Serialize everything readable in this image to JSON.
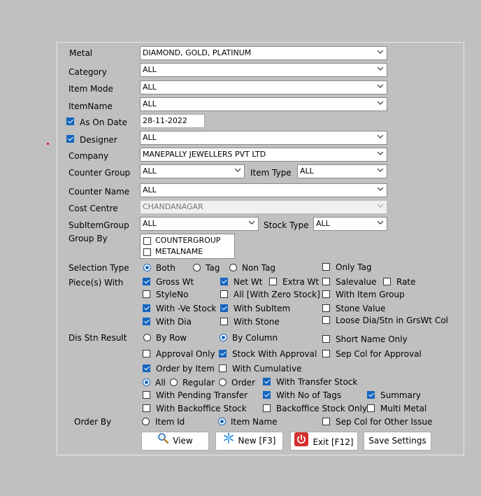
{
  "form": {
    "metal": {
      "label": "Metal",
      "value": "DIAMOND, GOLD, PLATINUM"
    },
    "category": {
      "label": "Category",
      "value": "ALL"
    },
    "item_mode": {
      "label": "Item Mode",
      "value": "ALL"
    },
    "item_name": {
      "label": "ItemName",
      "value": "ALL"
    },
    "as_on_date": {
      "label": "As On Date",
      "value": "28-11-2022",
      "checked": true
    },
    "designer": {
      "label": "Designer",
      "value": "ALL",
      "checked": true
    },
    "company": {
      "label": "Company",
      "value": "MANEPALLY JEWELLERS PVT LTD"
    },
    "counter_group": {
      "label": "Counter Group",
      "value": "ALL"
    },
    "item_type": {
      "label": "Item Type",
      "value": "ALL"
    },
    "counter_name": {
      "label": "Counter Name",
      "value": "ALL"
    },
    "cost_centre": {
      "label": "Cost Centre",
      "value": "CHANDANAGAR"
    },
    "sub_item_group": {
      "label": "SubItemGroup",
      "value": "ALL"
    },
    "stock_type": {
      "label": "Stock Type",
      "value": "ALL"
    },
    "group_by": {
      "label": "Group By",
      "items": [
        "COUNTERGROUP",
        "METALNAME"
      ]
    }
  },
  "selection_type": {
    "label": "Selection Type",
    "options": [
      "Both",
      "Tag",
      "Non Tag"
    ],
    "selected": "Both",
    "only_tag": "Only Tag"
  },
  "pieces_with": {
    "label": "Piece(s) With",
    "gross_wt": "Gross Wt",
    "net_wt": "Net Wt",
    "extra_wt": "Extra Wt",
    "salevalue": "Salevalue",
    "rate": "Rate",
    "style_no": "StyleNo",
    "all_zero_stock": "All [With Zero Stock]",
    "with_item_group": "With  Item Group",
    "with_ve_stock": "With -Ve Stock",
    "with_subitem": "With SubItem",
    "stone_value": "Stone Value",
    "with_dia": "With Dia",
    "with_stone": "With Stone",
    "loose_dia": "Loose Dia/Stn in GrsWt Col"
  },
  "dis_stn": {
    "label": "Dis Stn Result",
    "by_row": "By Row",
    "by_column": "By Column",
    "selected": "By Column",
    "short_name_only": "Short Name Only"
  },
  "options": {
    "approval_only": "Approval Only",
    "stock_with_approval": "Stock With Approval",
    "sep_col_approval": "Sep Col for Approval",
    "order_by_item": "Order by Item",
    "with_cumulative": "With Cumulative",
    "all": "All",
    "regular": "Regular",
    "order": "Order",
    "selected_mode": "All",
    "with_transfer_stock": "With Transfer Stock",
    "with_pending_transfer": "With Pending Transfer",
    "with_no_of_tags": "With No of Tags",
    "summary": "Summary",
    "with_backoffice_stock": "With Backoffice Stock",
    "backoffice_stock_only": "Backoffice Stock Only",
    "multi_metal": "Multi Metal"
  },
  "order_by": {
    "label": "Order By",
    "item_id": "Item Id",
    "item_name": "Item Name",
    "selected": "Item Name",
    "sep_col_other_issue": "Sep Col for Other Issue"
  },
  "buttons": {
    "view": "View",
    "new": "New [F3]",
    "exit": "Exit [F12]",
    "save_settings": "Save Settings"
  },
  "colors": {
    "background": "#c0c0c0",
    "accent": "#1565c0",
    "exit_icon": "#d32f2f"
  },
  "icons": {
    "view": "magnifier-icon",
    "new": "snowflake-icon",
    "exit": "power-icon",
    "dropdown": "chevron-down-icon"
  }
}
